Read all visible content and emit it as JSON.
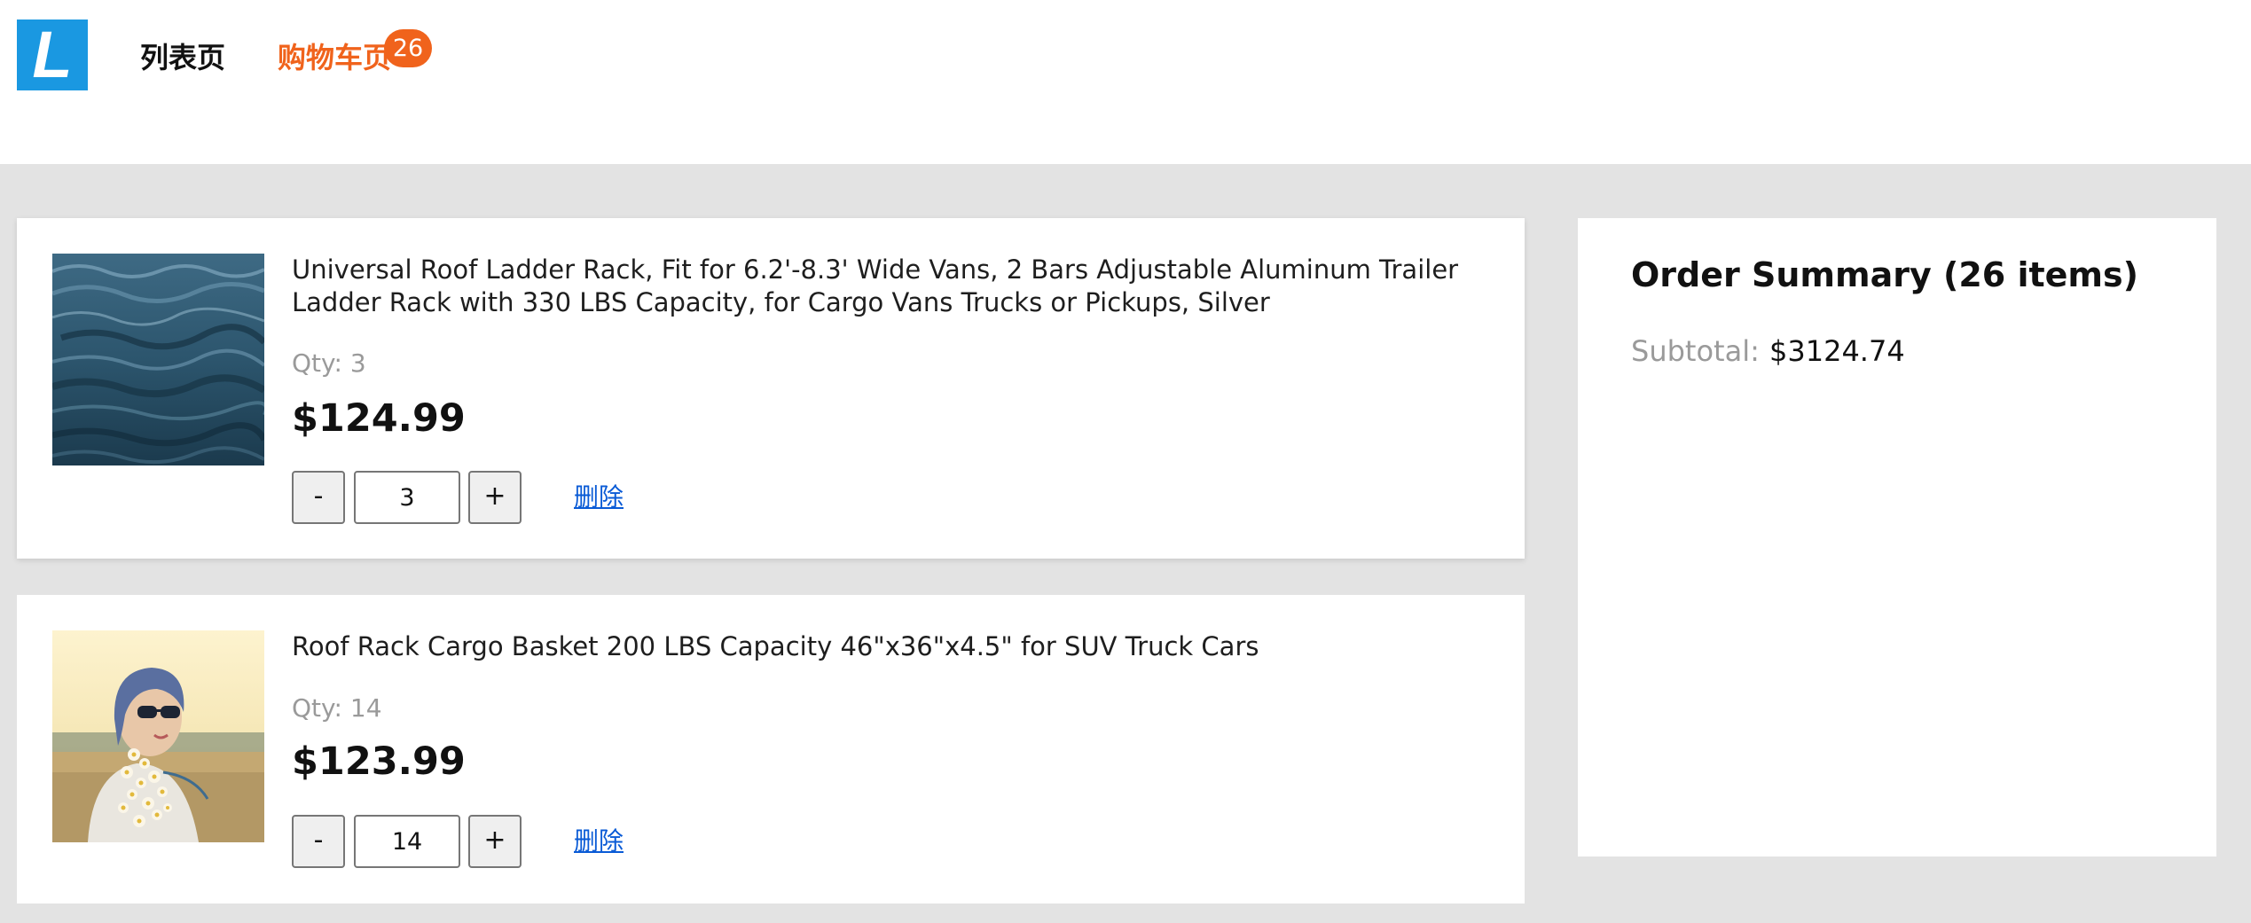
{
  "header": {
    "logo_letter": "L",
    "nav": {
      "list_label": "列表页",
      "cart_label": "购物车页",
      "cart_badge": "26"
    }
  },
  "cart": {
    "items": [
      {
        "title": "Universal Roof Ladder Rack, Fit for 6.2'-8.3' Wide Vans, 2 Bars Adjustable Aluminum Trailer Ladder Rack with 330 LBS Capacity, for Cargo Vans Trucks or Pickups, Silver",
        "qty_text": "Qty: 3",
        "price": "$124.99",
        "quantity": "3",
        "decrement_label": "-",
        "increment_label": "+",
        "remove_label": "删除",
        "image": "water-waves-photo"
      },
      {
        "title": "Roof Rack Cargo Basket 200 LBS Capacity 46\"x36\"x4.5\" for SUV Truck Cars",
        "qty_text": "Qty: 14",
        "price": "$123.99",
        "quantity": "14",
        "decrement_label": "-",
        "increment_label": "+",
        "remove_label": "删除",
        "image": "woman-with-flowers-photo"
      }
    ]
  },
  "summary": {
    "title": "Order Summary (26 items)",
    "subtotal_label": "Subtotal:",
    "subtotal_value": "$3124.74"
  },
  "colors": {
    "accent_orange": "#f0631c",
    "logo_blue": "#1a98e1",
    "link_blue": "#0a5bd6",
    "background_gray": "#e3e3e3"
  }
}
